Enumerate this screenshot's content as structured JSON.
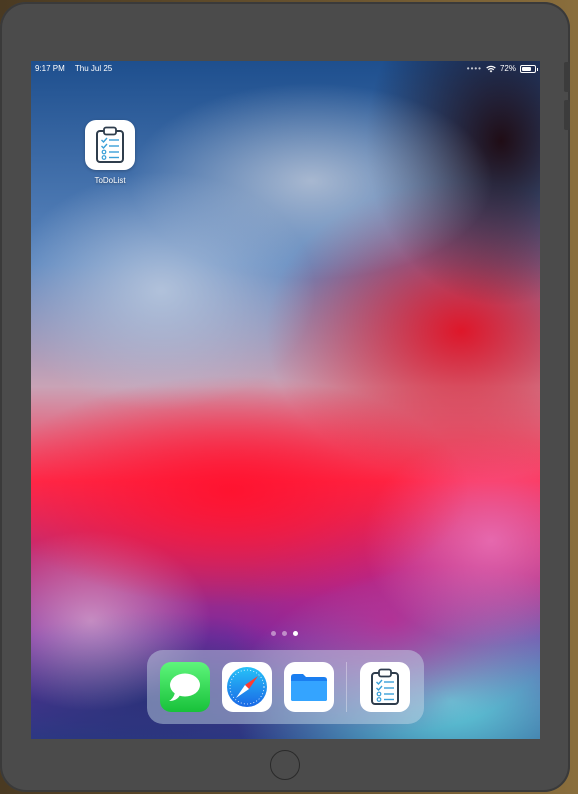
{
  "status_bar": {
    "time": "9:17 PM",
    "date": "Thu Jul 25",
    "battery": "72%",
    "battery_level": 0.72
  },
  "home_screen": {
    "apps": [
      {
        "label": "ToDoList",
        "icon": "clipboard-checklist-icon"
      }
    ]
  },
  "page_indicator": {
    "count": 3,
    "active_index": 2
  },
  "dock": {
    "apps": [
      {
        "name": "Messages",
        "icon": "messages-icon",
        "color": "#2fd055"
      },
      {
        "name": "Safari",
        "icon": "safari-compass-icon",
        "color": "#1e90f5"
      },
      {
        "name": "Files",
        "icon": "files-folder-icon",
        "color": "#1a7ef0"
      }
    ],
    "recent_apps": [
      {
        "name": "ToDoList",
        "icon": "clipboard-checklist-icon"
      }
    ]
  },
  "colors": {
    "device_bezel": "#4b4b4b",
    "checklist_accent": "#3aa0d8"
  }
}
